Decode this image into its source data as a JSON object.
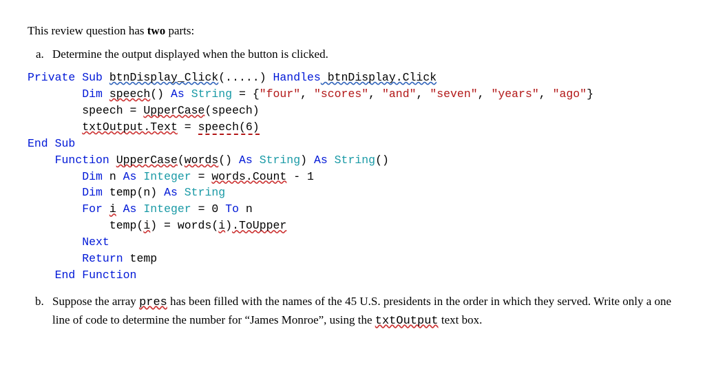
{
  "intro": {
    "prefix": "This review question has ",
    "bold": "two",
    "suffix": " parts:"
  },
  "partA": {
    "prompt": "Determine the output displayed when the button is clicked.",
    "code": {
      "l1": {
        "kw1": "Private Sub",
        "fn": "btnDisplay_Click",
        "par1": "(",
        "dots": ".....",
        "par2": ") ",
        "kw2": "Handles",
        "ev": " btnDisplay.Click"
      },
      "l2": {
        "kw": "Dim",
        "var": "speech",
        "par": "()",
        "as": " As ",
        "ty": "String",
        "eq": " = {",
        "s1": "\"four\"",
        "c1": ", ",
        "s2": "\"scores\"",
        "c2": ", ",
        "s3": "\"and\"",
        "c3": ", ",
        "s4": "\"seven\"",
        "c4": ", ",
        "s5": "\"years\"",
        "c5": ", ",
        "s6": "\"ago\"",
        "end": "}"
      },
      "l3": {
        "lhs": "speech = ",
        "fn": "UpperCase",
        "rhs": "(speech)"
      },
      "l4": {
        "lhs": "txtOutput.Text",
        "eq": " = ",
        "rhs": "speech(6)"
      },
      "l5": {
        "kw": "End Sub"
      },
      "l6": {
        "kw1": "Function",
        "sp1": " ",
        "fn": "UpperCase",
        "par1": "(",
        "arg": "words",
        "par2": "()",
        "as": " As ",
        "ty1": "String",
        "par3": ") ",
        "as2": "As ",
        "ty2": "String",
        "par4": "()"
      },
      "l7": {
        "kw": "Dim",
        "var": " n ",
        "as": "As ",
        "ty": "Integer",
        "eq": " = ",
        "rhs": "words.Count",
        "tail": " - 1"
      },
      "l8": {
        "kw": "Dim",
        "mid": " temp(n) ",
        "as": "As ",
        "ty": "String"
      },
      "l9": {
        "kw": "For",
        "sp": " ",
        "var": "i",
        "as": " As ",
        "ty": "Integer",
        "eq": " = 0 ",
        "to": "To",
        "n": " n"
      },
      "l10": {
        "lhs": "temp(",
        "i1": "i",
        "mid": ") = words(",
        "i2": "i",
        "par": ")",
        "dot": ".ToUpper"
      },
      "l11": {
        "kw": "Next"
      },
      "l12": {
        "kw": "Return",
        "v": " temp"
      },
      "l13": {
        "kw": "End Function"
      }
    }
  },
  "partB": {
    "t1": "Suppose the array ",
    "pres": "pres",
    "t2": " has been filled with the names of the 45 U.S. presidents in the order in which they served. Write only a one line of code to determine the number for “James Monroe”, using the ",
    "txtout": "txtOutput",
    "t3": " text box."
  }
}
